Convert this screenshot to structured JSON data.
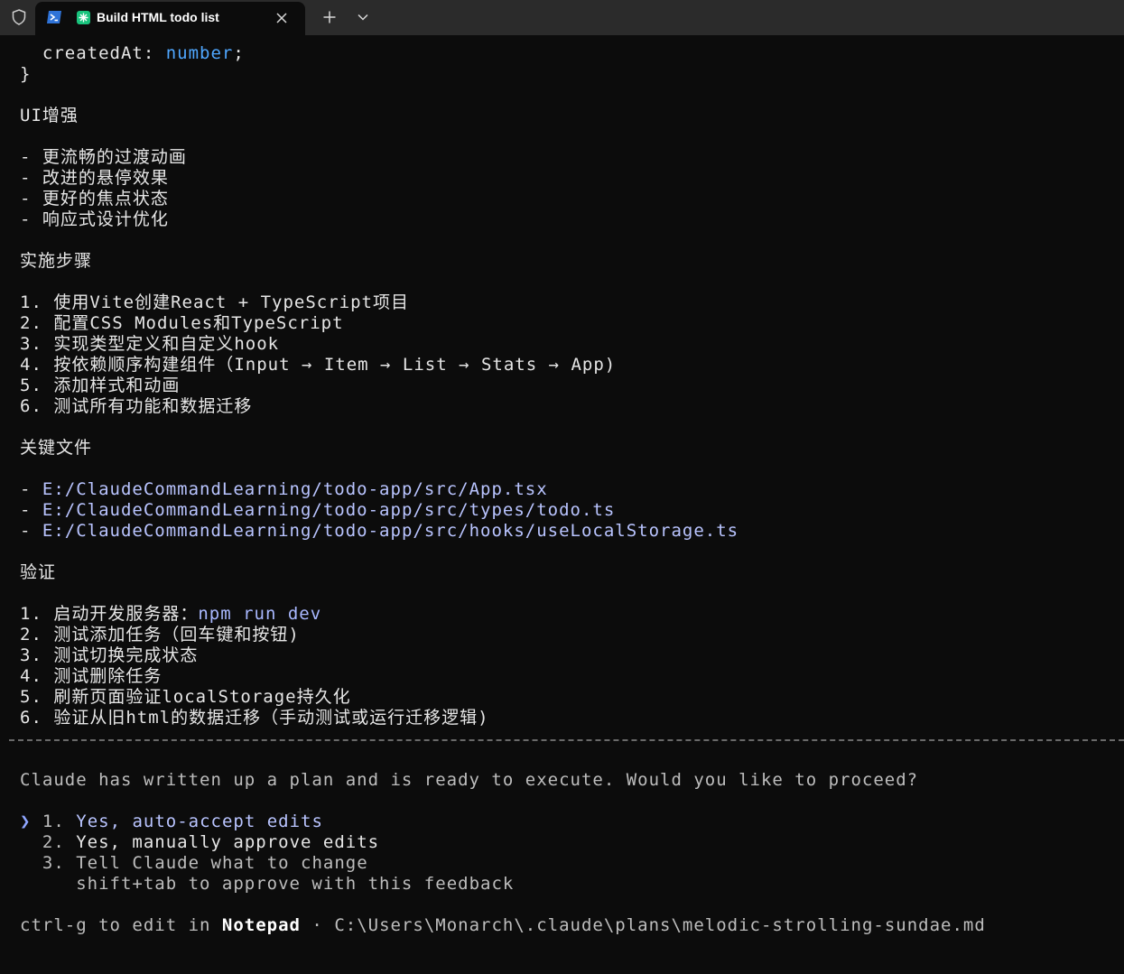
{
  "window": {
    "tab_title": "Build HTML todo list",
    "icons": [
      "shield-icon",
      "powershell-icon",
      "app-icon",
      "close-icon",
      "plus-icon",
      "chevron-down-icon"
    ]
  },
  "code": {
    "field_name": "  createdAt: ",
    "field_type": "number",
    "field_end": ";",
    "close_brace": "}"
  },
  "ui_section": {
    "heading": "UI增强",
    "items": [
      "- 更流畅的过渡动画",
      "- 改进的悬停效果",
      "- 更好的焦点状态",
      "- 响应式设计优化"
    ]
  },
  "steps_section": {
    "heading": "实施步骤",
    "items": [
      "1. 使用Vite创建React + TypeScript项目",
      "2. 配置CSS Modules和TypeScript",
      "3. 实现类型定义和自定义hook",
      "4. 按依赖顺序构建组件（Input → Item → List → Stats → App)",
      "5. 添加样式和动画",
      "6. 测试所有功能和数据迁移"
    ]
  },
  "files_section": {
    "heading": "关键文件",
    "bullet": "- ",
    "paths": [
      "E:/ClaudeCommandLearning/todo-app/src/App.tsx",
      "E:/ClaudeCommandLearning/todo-app/src/types/todo.ts",
      "E:/ClaudeCommandLearning/todo-app/src/hooks/useLocalStorage.ts"
    ]
  },
  "verify_section": {
    "heading": "验证",
    "first_prefix": "1. 启动开发服务器：",
    "first_cmd": "npm run dev",
    "items": [
      "2. 测试添加任务（回车键和按钮)",
      "3. 测试切换完成状态",
      "4. 测试删除任务",
      "5. 刷新页面验证localStorage持久化",
      "6. 验证从旧html的数据迁移（手动测试或运行迁移逻辑)"
    ]
  },
  "prompt": {
    "question": "Claude has written up a plan and is ready to execute. Would you like to proceed?",
    "cursor": "❯",
    "options": [
      {
        "number": "1.",
        "label": "Yes, auto-accept edits"
      },
      {
        "number": "2.",
        "label": "Yes, manually approve edits"
      },
      {
        "number": "3.",
        "label": "Tell Claude what to change"
      }
    ],
    "option3_hint": "shift+tab to approve with this feedback"
  },
  "footer": {
    "prefix": "ctrl-g to edit in ",
    "editor": "Notepad",
    "separator": " · ",
    "plan_path": "C:\\Users\\Monarch\\.claude\\plans\\melodic-strolling-sundae.md"
  },
  "colors": {
    "background": "#0c0c0c",
    "titlebar": "#2b2b2b",
    "keyword": "#4fa7ff",
    "path": "#b9c4ff",
    "text": "#e6e6e6"
  }
}
